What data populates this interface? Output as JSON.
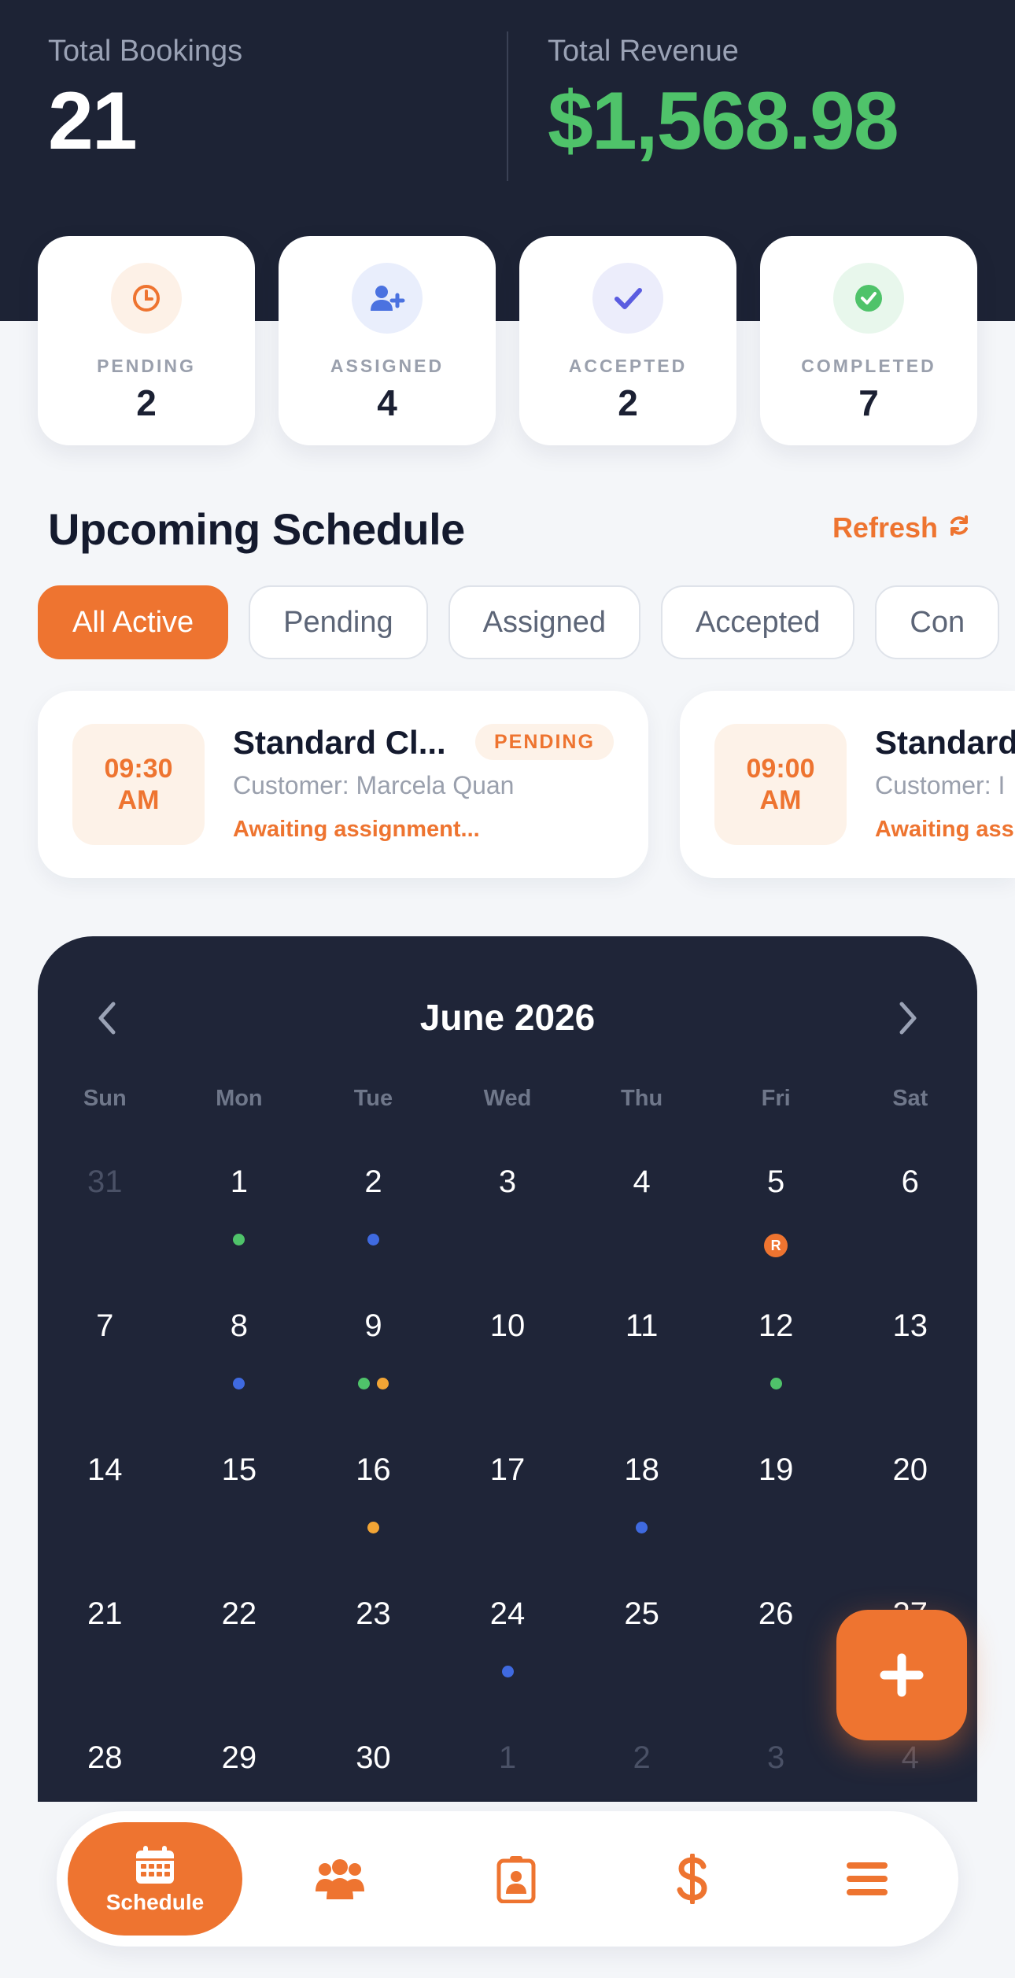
{
  "summary": {
    "bookings_label": "Total Bookings",
    "bookings_value": "21",
    "revenue_label": "Total Revenue",
    "revenue_value": "$1,568.98"
  },
  "status_cards": [
    {
      "label": "PENDING",
      "value": "2",
      "icon": "clock-icon",
      "color": "#ee7430",
      "bg": "#fdf1e7"
    },
    {
      "label": "ASSIGNED",
      "value": "4",
      "icon": "user-plus-icon",
      "color": "#4b72e0",
      "bg": "#e9eefc"
    },
    {
      "label": "ACCEPTED",
      "value": "2",
      "icon": "check-icon",
      "color": "#5a5ce0",
      "bg": "#ecedfb"
    },
    {
      "label": "COMPLETED",
      "value": "7",
      "icon": "check-circle-icon",
      "color": "#4fc36a",
      "bg": "#e8f7ec"
    }
  ],
  "schedule": {
    "title": "Upcoming Schedule",
    "refresh_label": "Refresh",
    "filters": [
      "All Active",
      "Pending",
      "Assigned",
      "Accepted",
      "Con"
    ],
    "active_filter": "All Active",
    "items": [
      {
        "time": "09:30",
        "period": "AM",
        "service": "Standard Cl...",
        "customer": "Customer: Marcela Quan",
        "status": "PENDING",
        "note": "Awaiting assignment..."
      },
      {
        "time": "09:00",
        "period": "AM",
        "service": "Standard",
        "customer": "Customer: I",
        "status": "",
        "note": "Awaiting ass"
      }
    ]
  },
  "calendar": {
    "month": "June 2026",
    "weekdays": [
      "Sun",
      "Mon",
      "Tue",
      "Wed",
      "Thu",
      "Fri",
      "Sat"
    ],
    "weeks": [
      [
        {
          "d": "31",
          "muted": true
        },
        {
          "d": "1",
          "dots": [
            "g"
          ]
        },
        {
          "d": "2",
          "dots": [
            "b"
          ]
        },
        {
          "d": "3"
        },
        {
          "d": "4"
        },
        {
          "d": "5",
          "badge": "R"
        },
        {
          "d": "6"
        }
      ],
      [
        {
          "d": "7"
        },
        {
          "d": "8",
          "dots": [
            "b"
          ]
        },
        {
          "d": "9",
          "dots": [
            "g",
            "o"
          ]
        },
        {
          "d": "10"
        },
        {
          "d": "11"
        },
        {
          "d": "12",
          "dots": [
            "g"
          ]
        },
        {
          "d": "13"
        }
      ],
      [
        {
          "d": "14"
        },
        {
          "d": "15"
        },
        {
          "d": "16",
          "dots": [
            "o"
          ]
        },
        {
          "d": "17"
        },
        {
          "d": "18",
          "dots": [
            "b"
          ]
        },
        {
          "d": "19"
        },
        {
          "d": "20"
        }
      ],
      [
        {
          "d": "21"
        },
        {
          "d": "22"
        },
        {
          "d": "23"
        },
        {
          "d": "24",
          "dots": [
            "b"
          ]
        },
        {
          "d": "25"
        },
        {
          "d": "26"
        },
        {
          "d": "27"
        }
      ],
      [
        {
          "d": "28"
        },
        {
          "d": "29"
        },
        {
          "d": "30"
        },
        {
          "d": "1",
          "muted": true
        },
        {
          "d": "2",
          "muted": true
        },
        {
          "d": "3",
          "muted": true
        },
        {
          "d": "4",
          "muted": true
        }
      ]
    ]
  },
  "fab": {
    "icon": "plus-icon"
  },
  "tabbar": {
    "items": [
      {
        "label": "Schedule",
        "icon": "calendar-icon",
        "active": true
      },
      {
        "label": "",
        "icon": "team-icon"
      },
      {
        "label": "",
        "icon": "id-badge-icon"
      },
      {
        "label": "",
        "icon": "dollar-icon"
      },
      {
        "label": "",
        "icon": "menu-icon"
      }
    ]
  },
  "colors": {
    "accent": "#ee7430",
    "dark": "#1d2335",
    "revenue": "#4fc36a"
  }
}
